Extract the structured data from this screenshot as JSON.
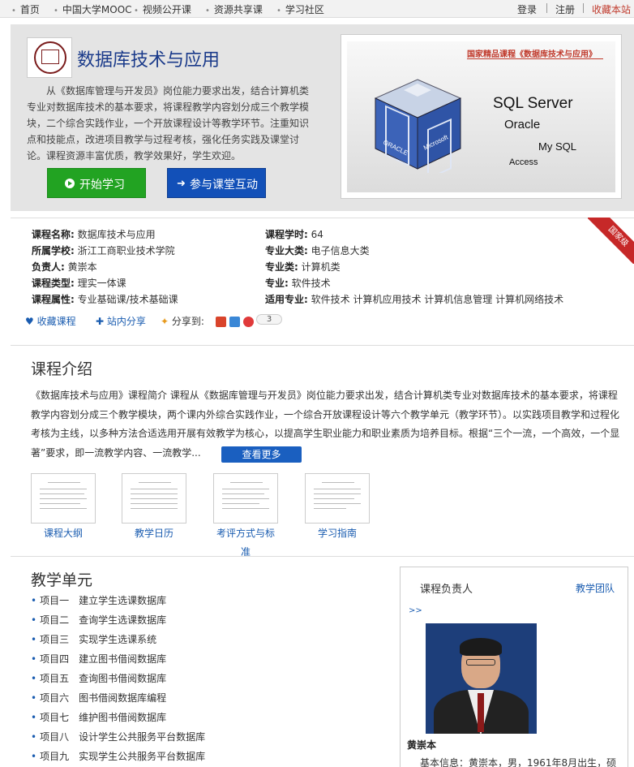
{
  "topnav": {
    "items": [
      "首页",
      "中国大学MOOC",
      "视频公开课",
      "资源共享课",
      "学习社区"
    ],
    "login": "登录",
    "register": "注册",
    "bookmark": "收藏本站"
  },
  "hero": {
    "title": "数据库技术与应用",
    "description": "从《数据库管理与开发员》岗位能力要求出发，结合计算机类专业对数据库技术的基本要求，将课程教学内容划分成三个教学模块，二个综合实践作业，一个开放课程设计等教学环节。注重知识点和技能点，改进项目教学与过程考核，强化任务实践及课堂讨论。课程资源丰富优质，教学效果好，学生欢迎。",
    "start_button": "开始学习",
    "interact_button": "参与课堂互动",
    "promo": {
      "tag": "国家精品课程《数据库技术与应用》",
      "line1": "SQL Server",
      "line2": "Oracle",
      "line3": "My SQL",
      "line4": "Access",
      "cube_label_left": "ORACLE",
      "cube_label_right": "Microsoft"
    }
  },
  "info": {
    "badge": "国家级",
    "rows": [
      {
        "label": "课程名称:",
        "value": "数据库技术与应用"
      },
      {
        "label": "所属学校:",
        "value": "浙江工商职业技术学院"
      },
      {
        "label": "负责人:",
        "value": "黄崇本"
      },
      {
        "label": "课程类型:",
        "value": "理实一体课"
      },
      {
        "label": "课程属性:",
        "value": "专业基础课/技术基础课"
      },
      {
        "label": "课程学时:",
        "value": "64"
      },
      {
        "label": "专业大类:",
        "value": "电子信息大类"
      },
      {
        "label": "专业类:",
        "value": "计算机类"
      },
      {
        "label": "专业:",
        "value": "软件技术"
      },
      {
        "label": "适用专业:",
        "value": "软件技术 计算机应用技术 计算机信息管理 计算机网络技术"
      }
    ],
    "favorite": "收藏课程",
    "site_share": "站内分享",
    "share_to": "分享到:",
    "share_count": "3"
  },
  "intro": {
    "title": "课程介绍",
    "text": "《数据库技术与应用》课程简介 课程从《数据库管理与开发员》岗位能力要求出发，结合计算机类专业对数据库技术的基本要求，将课程教学内容划分成三个教学模块，两个课内外综合实践作业，一个综合开放课程设计等六个教学单元（教学环节）。以实践项目教学和过程化考核为主线，以多种方法合适选用开展有效教学为核心，以提高学生职业能力和职业素质为培养目标。根据“三个一流，一个高效，一个显著”要求，即一流教学内容、一流教学...",
    "more_button": "查看更多",
    "docs": [
      "课程大纲",
      "教学日历",
      "考评方式与标准",
      "学习指南"
    ]
  },
  "units": {
    "title": "教学单元",
    "items": [
      {
        "num": "项目一",
        "name": "建立学生选课数据库"
      },
      {
        "num": "项目二",
        "name": "查询学生选课数据库"
      },
      {
        "num": "项目三",
        "name": "实现学生选课系统"
      },
      {
        "num": "项目四",
        "name": "建立图书借阅数据库"
      },
      {
        "num": "项目五",
        "name": "查询图书借阅数据库"
      },
      {
        "num": "项目六",
        "name": "图书借阅数据库编程"
      },
      {
        "num": "项目七",
        "name": "维护图书借阅数据库"
      },
      {
        "num": "项目八",
        "name": "设计学生公共服务平台数据库"
      },
      {
        "num": "项目九",
        "name": "实现学生公共服务平台数据库"
      }
    ]
  },
  "teacher": {
    "title": "课程负责人",
    "team_link": "教学团队",
    "more": ">>",
    "name": "黄崇本",
    "basic_info": "基本信息：黄崇本，男，1961年8月出生，硕"
  },
  "colors": {
    "link_blue": "#1a5cb0",
    "start_green": "#22a322",
    "interact_blue": "#1250b8",
    "badge_red": "#c62828",
    "bookmark_red": "#c0392b"
  }
}
